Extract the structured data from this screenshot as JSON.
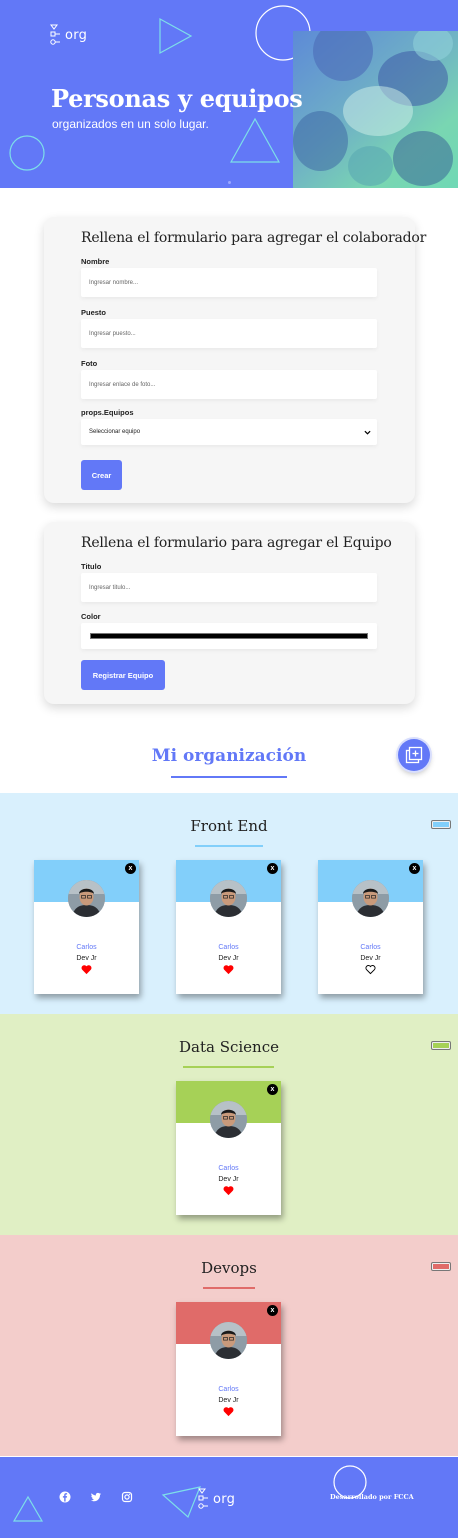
{
  "header": {
    "logo_text": "org",
    "title": "Personas y equipos",
    "subtitle": "organizados en un solo lugar."
  },
  "colaborador_form": {
    "title": "Rellena el formulario para agregar el colaborador",
    "nombre_label": "Nombre",
    "nombre_placeholder": "Ingresar nombre...",
    "puesto_label": "Puesto",
    "puesto_placeholder": "Ingresar puesto...",
    "foto_label": "Foto",
    "foto_placeholder": "Ingresar enlace de foto...",
    "equipo_label": "props.Equipos",
    "equipo_selected": "Seleccionar equipo",
    "submit_label": "Crear"
  },
  "equipo_form": {
    "title": "Rellena el formulario para agregar el Equipo",
    "titulo_label": "Titulo",
    "titulo_placeholder": "Ingresar titulo...",
    "color_label": "Color",
    "color_value": "#000000",
    "submit_label": "Registrar Equipo"
  },
  "organization": {
    "title": "Mi organización"
  },
  "teams": [
    {
      "name": "Front End",
      "bg_color": "#d9f0fd",
      "primary_color": "#82cffa",
      "members": [
        {
          "name": "Carlos",
          "role": "Dev Jr",
          "favorite": true
        },
        {
          "name": "Carlos",
          "role": "Dev Jr",
          "favorite": true
        },
        {
          "name": "Carlos",
          "role": "Dev Jr",
          "favorite": false
        }
      ]
    },
    {
      "name": "Data Science",
      "bg_color": "#e0efc4",
      "primary_color": "#a6d157",
      "members": [
        {
          "name": "Carlos",
          "role": "Dev Jr",
          "favorite": true
        }
      ]
    },
    {
      "name": "Devops",
      "bg_color": "#f3cdcb",
      "primary_color": "#e06b69",
      "members": [
        {
          "name": "Carlos",
          "role": "Dev Jr",
          "favorite": true
        }
      ]
    }
  ],
  "footer": {
    "logo_text": "org",
    "credit": "Desarrollado por FCCA",
    "social_icons": [
      "facebook-icon",
      "twitter-icon",
      "instagram-icon"
    ]
  },
  "colors": {
    "brand": "#6278f7",
    "heart": "#ff0000",
    "form_bg": "#f6f6f6"
  }
}
